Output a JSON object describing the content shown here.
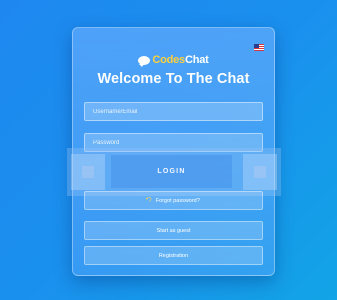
{
  "brand": {
    "logo_part1": "Codes",
    "logo_part2": "Chat",
    "brand_color": "#ffcf3a"
  },
  "header": {
    "title": "Welcome To The Chat",
    "language_flag": "us-flag-icon"
  },
  "form": {
    "username_placeholder": "Username/Email",
    "password_placeholder": "Password",
    "login_label": "LOGIN"
  },
  "actions": {
    "forgot_password_label": "Forgot password?",
    "start_guest_label": "Start as guest",
    "register_label": "Registration",
    "forgot_icon": "key-icon"
  },
  "colors": {
    "background_start": "#1e88f0",
    "background_end": "#12a4e6",
    "accent": "#ffffff"
  }
}
